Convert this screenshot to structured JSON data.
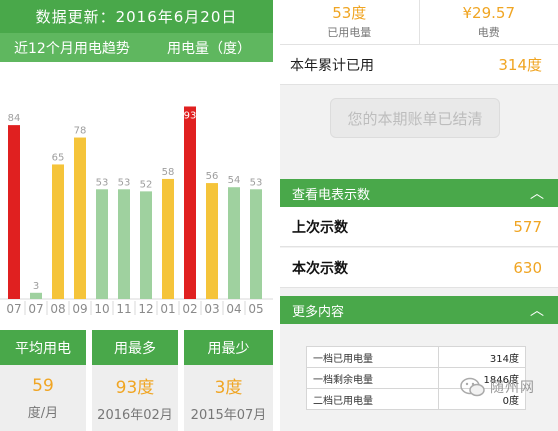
{
  "left": {
    "header": "数据更新：2016年6月20日",
    "subheader_left": "近12个月用电趋势",
    "subheader_right": "用电量（度）",
    "stats": [
      {
        "head": "平均用电",
        "value": "59",
        "unit": "度/月"
      },
      {
        "head": "用最多",
        "value": "93度",
        "unit": "2016年02月"
      },
      {
        "head": "用最少",
        "value": "3度",
        "unit": "2015年07月"
      }
    ]
  },
  "chart_data": {
    "type": "bar",
    "categories": [
      "07",
      "07",
      "08",
      "09",
      "10",
      "11",
      "12",
      "01",
      "02",
      "03",
      "04",
      "05"
    ],
    "values": [
      84,
      3,
      65,
      78,
      53,
      53,
      52,
      58,
      93,
      56,
      54,
      53
    ],
    "bar_colors": [
      "#e02020",
      "#9fd19f",
      "#f5c43a",
      "#f5c43a",
      "#9fd19f",
      "#9fd19f",
      "#9fd19f",
      "#f5c43a",
      "#e02020",
      "#f5c43a",
      "#9fd19f",
      "#9fd19f"
    ],
    "label_colors": [
      "#9e9e9e",
      "#9e9e9e",
      "#9e9e9e",
      "#9e9e9e",
      "#9e9e9e",
      "#9e9e9e",
      "#9e9e9e",
      "#9e9e9e",
      "#ffffff",
      "#9e9e9e",
      "#9e9e9e",
      "#9e9e9e"
    ],
    "ylim": [
      0,
      100
    ]
  },
  "right": {
    "usage_value": "53度",
    "usage_label": "已用电量",
    "fee_value": "¥29.57",
    "fee_label": "电费",
    "year_label": "本年累计已用",
    "year_value": "314度",
    "bill_button": "您的本期账单已结清",
    "meter_section": "查看电表示数",
    "last_reading_label": "上次示数",
    "last_reading_value": "577",
    "current_reading_label": "本次示数",
    "current_reading_value": "630",
    "more_section": "更多内容",
    "details": [
      {
        "label": "一档已用电量",
        "value": "314度"
      },
      {
        "label": "一档剩余电量",
        "value": "1846度"
      },
      {
        "label": "二档已用电量",
        "value": "0度"
      }
    ],
    "watermark": "随州网"
  },
  "colors": {
    "green": "#49a84a",
    "accent": "#f0a523"
  }
}
